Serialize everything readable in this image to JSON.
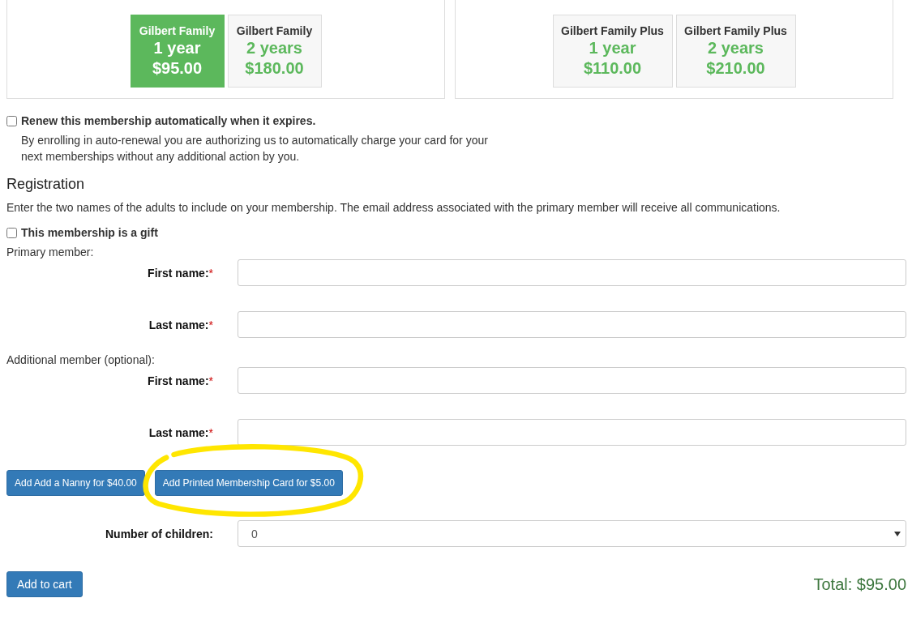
{
  "plans": [
    {
      "options": [
        {
          "name": "Gilbert Family",
          "term": "1 year",
          "price": "$95.00",
          "selected": true
        },
        {
          "name": "Gilbert Family",
          "term": "2 years",
          "price": "$180.00",
          "selected": false
        }
      ]
    },
    {
      "options": [
        {
          "name": "Gilbert Family Plus",
          "term": "1 year",
          "price": "$110.00",
          "selected": false
        },
        {
          "name": "Gilbert Family Plus",
          "term": "2 years",
          "price": "$210.00",
          "selected": false
        }
      ]
    }
  ],
  "auto_renew": {
    "label": "Renew this membership automatically when it expires.",
    "checked": false,
    "note": "By enrolling in auto-renewal you are authorizing us to automatically charge your card for your next memberships without any additional action by you."
  },
  "registration": {
    "title": "Registration",
    "intro": "Enter the two names of the adults to include on your membership. The email address associated with the primary member will receive all communications.",
    "gift": {
      "label": "This membership is a gift",
      "checked": false
    },
    "groups": [
      {
        "title": "Primary member:",
        "fields": [
          {
            "label": "First name:",
            "required_mark": "*"
          },
          {
            "label": "Last name:",
            "required_mark": "*"
          }
        ]
      },
      {
        "title": "Additional member (optional):",
        "fields": [
          {
            "label": "First name:",
            "required_mark": "*"
          },
          {
            "label": "Last name:",
            "required_mark": "*"
          }
        ]
      }
    ]
  },
  "addons": [
    {
      "label": "Add Add a Nanny for $40.00",
      "highlighted": false
    },
    {
      "label": "Add Printed Membership Card for $5.00",
      "highlighted": true
    }
  ],
  "children": {
    "label": "Number of children:",
    "value": "0"
  },
  "cart_button": "Add to cart",
  "total": "Total: $95.00"
}
